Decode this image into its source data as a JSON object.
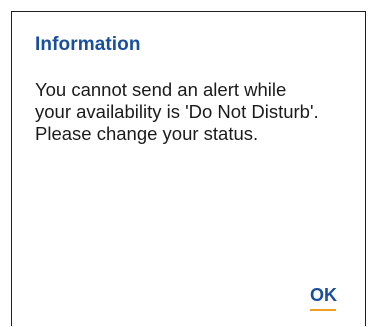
{
  "dialog": {
    "title": "Information",
    "message_lines": [
      "You cannot send an alert while",
      "your availability is 'Do Not Disturb'.",
      "Please change your status."
    ],
    "ok_label": "OK"
  },
  "colors": {
    "title": "#1a4f9c",
    "button": "#1a4f9c",
    "focus_underline": "#f0a020",
    "text": "#1b1b1b",
    "border": "#1f1f1f"
  }
}
